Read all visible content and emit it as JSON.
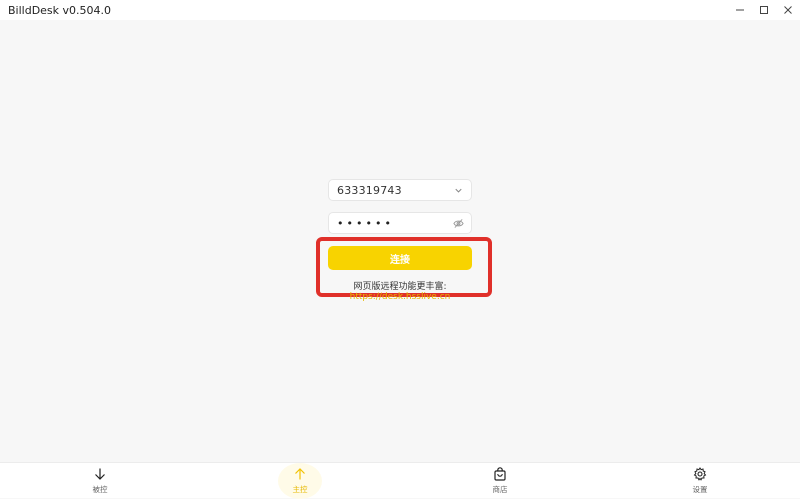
{
  "window": {
    "title": "BilldDesk v0.504.0"
  },
  "connect_form": {
    "device_id": "633319743",
    "password_masked": "••••••",
    "connect_label": "连接",
    "hint_text": "网页版远程功能更丰富:",
    "web_link": "https://desk.hsslive.cn"
  },
  "bottom_nav": {
    "items": [
      {
        "label": "被控",
        "icon": "arrow-down-icon",
        "active": false
      },
      {
        "label": "主控",
        "icon": "arrow-up-icon",
        "active": true
      },
      {
        "label": "商店",
        "icon": "shopping-bag-icon",
        "active": false
      },
      {
        "label": "设置",
        "icon": "gear-icon",
        "active": false
      }
    ]
  },
  "colors": {
    "accent": "#f8d300",
    "link": "#e6b800",
    "highlight": "#e0302a",
    "background": "#f7f7f7"
  }
}
